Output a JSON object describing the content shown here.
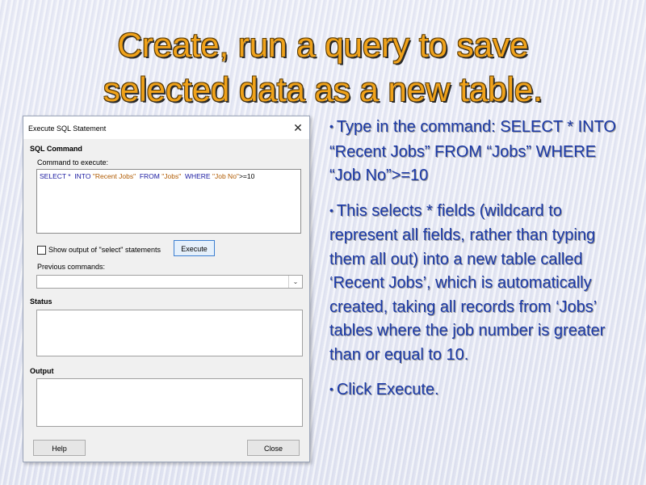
{
  "slide": {
    "title_line1": "Create, run a query to save",
    "title_line2": "selected data as a new table."
  },
  "dialog": {
    "title": "Execute SQL Statement",
    "close_glyph": "✕",
    "sql_command_heading": "SQL Command",
    "command_label": "Command to execute:",
    "command_value": "SELECT *  INTO \"Recent Jobs\"  FROM \"Jobs\"  WHERE \"Job No\">=10",
    "command_parts": {
      "p1": "SELECT *  INTO ",
      "p2": "\"Recent Jobs\"",
      "p3": "  FROM ",
      "p4": "\"Jobs\"",
      "p5": "  WHERE ",
      "p6": "\"Job No\"",
      "p7": ">=10"
    },
    "show_output_label": "Show output of \"select\" statements",
    "show_output_checked": false,
    "execute_label": "Execute",
    "previous_commands_label": "Previous commands:",
    "previous_commands_value": "",
    "status_heading": "Status",
    "output_heading": "Output",
    "help_label": "Help",
    "close_label": "Close"
  },
  "bullets": [
    "Type in the command: SELECT * INTO “Recent Jobs” FROM “Jobs” WHERE “Job No”>=10",
    "This selects * fields (wildcard to represent all fields, rather than typing them all out) into a new table called ‘Recent Jobs’, which is automatically created, taking all records from ‘Jobs’ tables where the job number is greater than or equal to 10.",
    "Click Execute."
  ],
  "colors": {
    "title": "#f0a21a",
    "bullet_text": "#1c3aa8",
    "sql_keyword": "#1a1aa0",
    "sql_string": "#b05a00"
  }
}
